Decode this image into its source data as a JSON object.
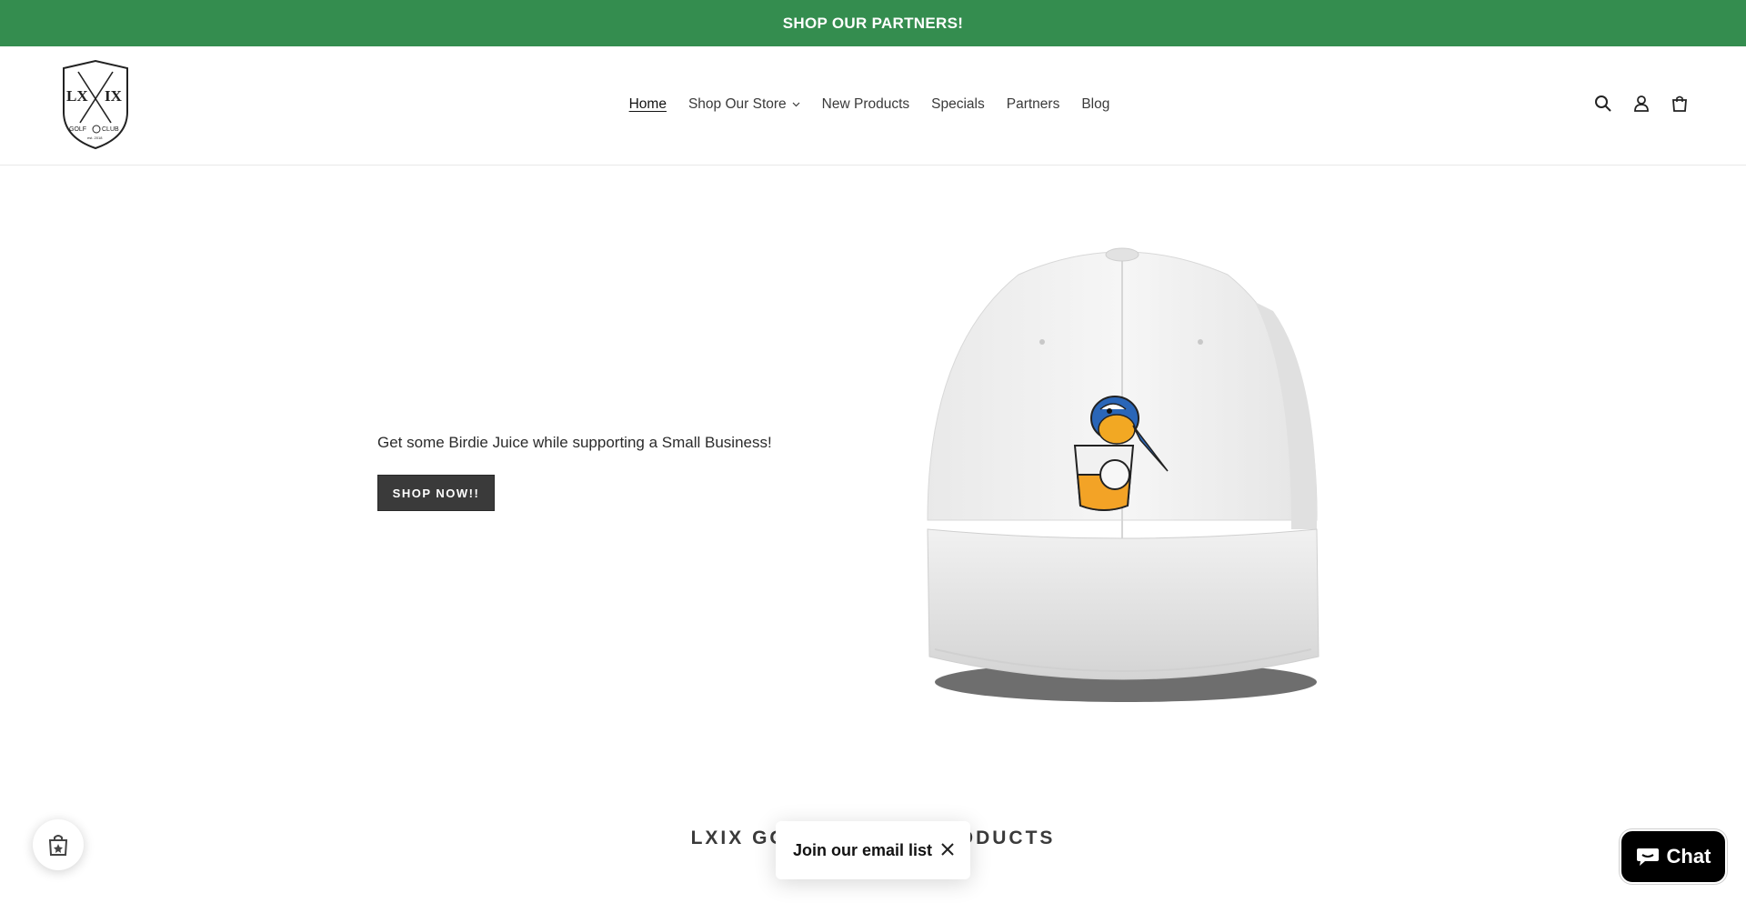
{
  "announcement": {
    "text": "SHOP OUR PARTNERS!",
    "bg": "#348d4f"
  },
  "logo": {
    "line1": "LX",
    "line2": "IX",
    "line3": "GOLF",
    "line4": "CLUB",
    "line5": "est. 2018"
  },
  "nav": {
    "home": "Home",
    "shop": "Shop Our Store",
    "new": "New Products",
    "specials": "Specials",
    "partners": "Partners",
    "blog": "Blog"
  },
  "header_icons": [
    "search-icon",
    "account-icon",
    "cart-icon"
  ],
  "hero": {
    "text": "Get some Birdie Juice while supporting a Small Business!",
    "button": "SHOP NOW!!"
  },
  "section": {
    "title_left": "LXIX GO",
    "title_right": "ODUCTS"
  },
  "email_popup": {
    "label": "Join our email list"
  },
  "chat": {
    "label": "Chat"
  }
}
